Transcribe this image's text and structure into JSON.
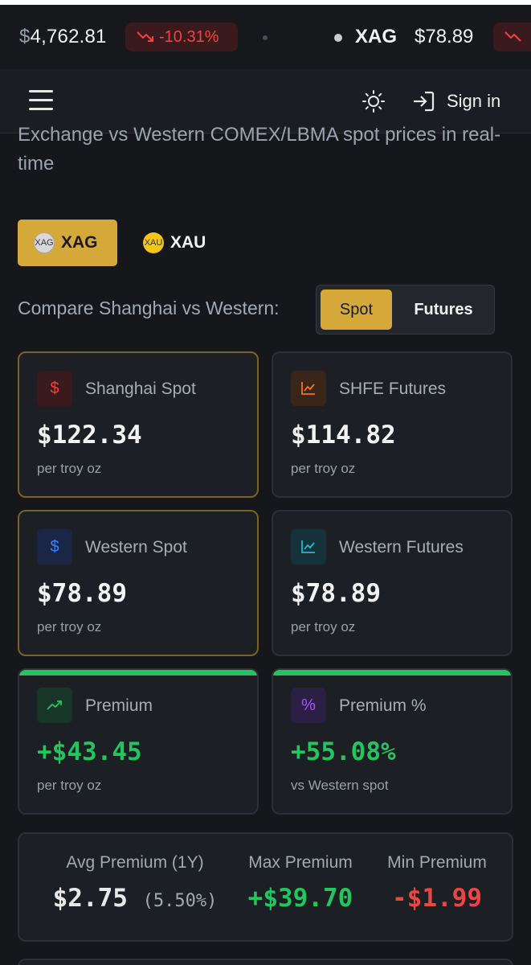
{
  "ticker": {
    "item1": {
      "currency_symbol": "$",
      "price": "4,762.81",
      "change": "-10.31%"
    },
    "item2": {
      "symbol": "XAG",
      "price": "$78.89"
    }
  },
  "header": {
    "sign_in_label": "Sign in"
  },
  "intro": {
    "clipped_line": "Shanghai Gold Exchange",
    "text": "Exchange vs Western COMEX/LBMA spot prices in real-time"
  },
  "metal_tabs": [
    {
      "symbol": "XAG",
      "coin_label": "XAG",
      "active": true
    },
    {
      "symbol": "XAU",
      "coin_label": "XAU",
      "active": false
    }
  ],
  "compare": {
    "label": "Compare Shanghai vs Western:",
    "options": [
      "Spot",
      "Futures"
    ],
    "selected": "Spot"
  },
  "cards": {
    "shanghai_spot": {
      "title": "Shanghai Spot",
      "value": "$122.34",
      "sub": "per troy oz",
      "icon": "dollar-icon"
    },
    "shfe_futures": {
      "title": "SHFE Futures",
      "value": "$114.82",
      "sub": "per troy oz",
      "icon": "chart-line-icon"
    },
    "western_spot": {
      "title": "Western Spot",
      "value": "$78.89",
      "sub": "per troy oz",
      "icon": "dollar-icon"
    },
    "western_futures": {
      "title": "Western Futures",
      "value": "$78.89",
      "sub": "per troy oz",
      "icon": "chart-line-icon"
    },
    "premium": {
      "title": "Premium",
      "value": "+$43.45",
      "sub": "per troy oz",
      "icon": "trending-up-icon"
    },
    "premium_pct": {
      "title": "Premium %",
      "value": "+55.08%",
      "sub": "vs Western spot",
      "icon": "percent-icon"
    }
  },
  "stats": {
    "avg": {
      "label": "Avg Premium (1Y)",
      "value": "$2.75",
      "pct": "(5.50%)"
    },
    "max": {
      "label": "Max Premium",
      "value": "+$39.70"
    },
    "min": {
      "label": "Min Premium",
      "value": "-$1.99"
    }
  },
  "colors": {
    "accent_gold": "#d4a93a",
    "positive": "#22c55e",
    "negative": "#ef4444",
    "background": "#15171b"
  }
}
